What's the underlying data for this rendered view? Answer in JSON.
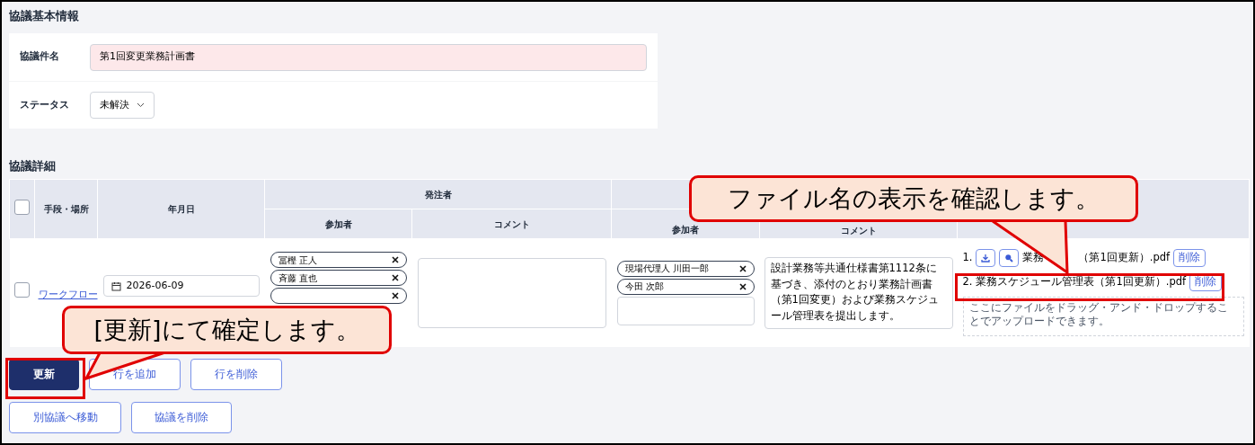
{
  "basic_info": {
    "title": "協議基本情報",
    "fields": [
      {
        "kind": "text",
        "label": "協議件名",
        "value": "第1回変更業務計画書"
      },
      {
        "kind": "select",
        "label": "ステータス",
        "value": "未解決"
      }
    ]
  },
  "details": {
    "title": "協議詳細",
    "header": {
      "select_all": {
        "checked": false
      },
      "method": "手段・場所",
      "date": "年月日",
      "client": {
        "label": "発注者",
        "participants": "参加者",
        "comment": "コメント"
      },
      "contractor": {
        "participants": "参加者",
        "comment": "コメント"
      }
    },
    "rows": [
      {
        "checked": false,
        "method": "ワークフロー",
        "date": "2026-06-09",
        "client": {
          "participants": [
            {
              "name": "冨樫 正人",
              "removable": true
            },
            {
              "name": "斉藤 直也",
              "removable": true
            },
            {
              "removable": true
            }
          ]
        },
        "contractor": {
          "participants": [
            {
              "name": "現場代理人 川田一郎",
              "removable": true
            },
            {
              "name": "今田 次郎",
              "removable": true
            }
          ],
          "comment": "設計業務等共通仕様書第1112条に基づき、添付のとおり業務計画書（第1回変更）および業務スケジュール管理表を提出します。"
        },
        "files": [
          {
            "kind": "actions",
            "number": "1.",
            "name_start": "業務",
            "name_end": "（第1回更新）.pdf",
            "delete": "削除"
          },
          {
            "kind": "plain",
            "number": "2.",
            "name_start": "業務スケジュール管理表（第1回更新）.pdf",
            "delete": "削除"
          }
        ],
        "dropzone": "ここにファイルをドラッグ・アンド・ドロップすることでアップロードできます。"
      }
    ]
  },
  "buttons": [
    {
      "kind": "primary",
      "label": "更新"
    },
    {
      "kind": "outline",
      "label": "行を追加"
    },
    {
      "kind": "outline",
      "label": "行を削除"
    },
    {
      "kind": "outline",
      "label": "別協議へ移動"
    },
    {
      "kind": "outline",
      "label": "協議を削除"
    }
  ],
  "callouts": [
    {
      "text": "[更新]にて確定します。"
    },
    {
      "text": "ファイル名の表示を確認します。"
    }
  ]
}
